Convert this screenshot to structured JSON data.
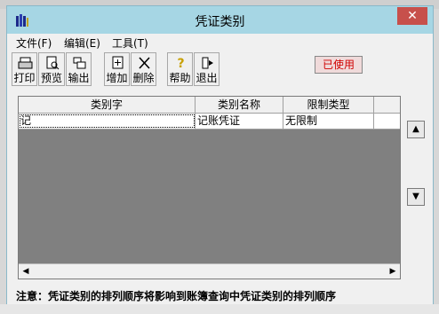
{
  "window": {
    "title": "凭证类别",
    "close_glyph": "✕"
  },
  "menu": [
    {
      "label": "文件(F)"
    },
    {
      "label": "编辑(E)"
    },
    {
      "label": "工具(T)"
    }
  ],
  "toolbar": [
    {
      "label": "打印",
      "icon": "printer-icon"
    },
    {
      "label": "预览",
      "icon": "preview-icon"
    },
    {
      "label": "输出",
      "icon": "export-icon"
    },
    {
      "label": "增加",
      "icon": "add-icon"
    },
    {
      "label": "删除",
      "icon": "delete-icon"
    },
    {
      "label": "帮助",
      "icon": "help-icon"
    },
    {
      "label": "退出",
      "icon": "exit-icon"
    }
  ],
  "status_badge": {
    "text": "已使用",
    "color": "#d00000"
  },
  "grid": {
    "columns": [
      "类别字",
      "类别名称",
      "限制类型"
    ],
    "rows": [
      [
        "记",
        "记账凭证",
        "无限制"
      ]
    ]
  },
  "side_buttons": {
    "up": "▲",
    "down": "▼"
  },
  "scroll": {
    "left": "◀",
    "right": "▶"
  },
  "note": "注意：凭证类别的排列顺序将影响到账簿查询中凭证类别的排列顺序",
  "colors": {
    "titlebar": "#a6d6e4",
    "close": "#c7504b",
    "grid_bg": "#808080"
  }
}
